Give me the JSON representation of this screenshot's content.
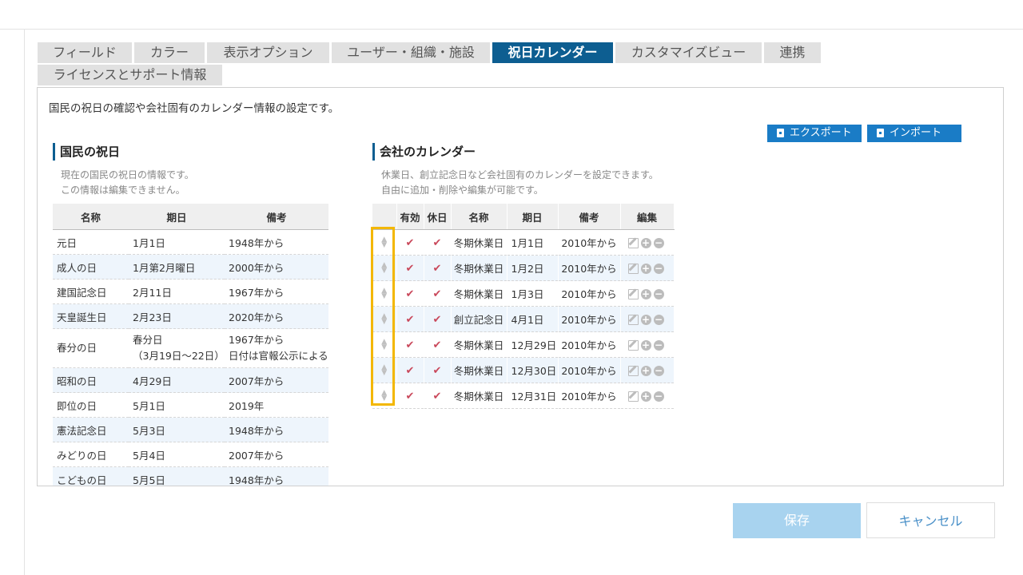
{
  "tabs": [
    {
      "label": "フィールド",
      "active": false
    },
    {
      "label": "カラー",
      "active": false
    },
    {
      "label": "表示オプション",
      "active": false
    },
    {
      "label": "ユーザー・組織・施設",
      "active": false
    },
    {
      "label": "祝日カレンダー",
      "active": true
    },
    {
      "label": "カスタマイズビュー",
      "active": false
    },
    {
      "label": "連携",
      "active": false
    },
    {
      "label": "ライセンスとサポート情報",
      "active": false
    }
  ],
  "panel": {
    "description": "国民の祝日の確認や会社固有のカレンダー情報の設定です。",
    "export_label": "エクスポート",
    "import_label": "インポート"
  },
  "national": {
    "title": "国民の祝日",
    "desc_line1": "現在の国民の祝日の情報です。",
    "desc_line2": "この情報は編集できません。",
    "headers": [
      "名称",
      "期日",
      "備考"
    ],
    "rows": [
      {
        "name": "元日",
        "date": "1月1日",
        "note": "1948年から"
      },
      {
        "name": "成人の日",
        "date": "1月第2月曜日",
        "note": "2000年から"
      },
      {
        "name": "建国記念日",
        "date": "2月11日",
        "note": "1967年から"
      },
      {
        "name": "天皇誕生日",
        "date": "2月23日",
        "note": "2020年から"
      },
      {
        "name": "春分の日",
        "date": "春分日",
        "date2": "（3月19日～22日）",
        "note": "1967年から",
        "note2": "日付は官報公示による"
      },
      {
        "name": "昭和の日",
        "date": "4月29日",
        "note": "2007年から"
      },
      {
        "name": "即位の日",
        "date": "5月1日",
        "note": "2019年"
      },
      {
        "name": "憲法記念日",
        "date": "5月3日",
        "note": "1948年から"
      },
      {
        "name": "みどりの日",
        "date": "5月4日",
        "note": "2007年から"
      },
      {
        "name": "こどもの日",
        "date": "5月5日",
        "note": "1948年から"
      }
    ]
  },
  "company": {
    "title": "会社のカレンダー",
    "desc_line1": "休業日、創立記念日など会社固有のカレンダーを設定できます。",
    "desc_line2": "自由に追加・削除や編集が可能です。",
    "headers": [
      "",
      "有効",
      "休日",
      "名称",
      "期日",
      "備考",
      "編集"
    ],
    "rows": [
      {
        "name": "冬期休業日",
        "date": "1月1日",
        "note": "2010年から"
      },
      {
        "name": "冬期休業日",
        "date": "1月2日",
        "note": "2010年から"
      },
      {
        "name": "冬期休業日",
        "date": "1月3日",
        "note": "2010年から"
      },
      {
        "name": "創立記念日",
        "date": "4月1日",
        "note": "2010年から"
      },
      {
        "name": "冬期休業日",
        "date": "12月29日",
        "note": "2010年から"
      },
      {
        "name": "冬期休業日",
        "date": "12月30日",
        "note": "2010年から"
      },
      {
        "name": "冬期休業日",
        "date": "12月31日",
        "note": "2010年から"
      }
    ]
  },
  "footer": {
    "save_label": "保存",
    "cancel_label": "キャンセル"
  },
  "colors": {
    "active_tab": "#0d5e91",
    "button_blue": "#1a7cc6",
    "highlight": "#f3b700",
    "check": "#c9475a"
  }
}
